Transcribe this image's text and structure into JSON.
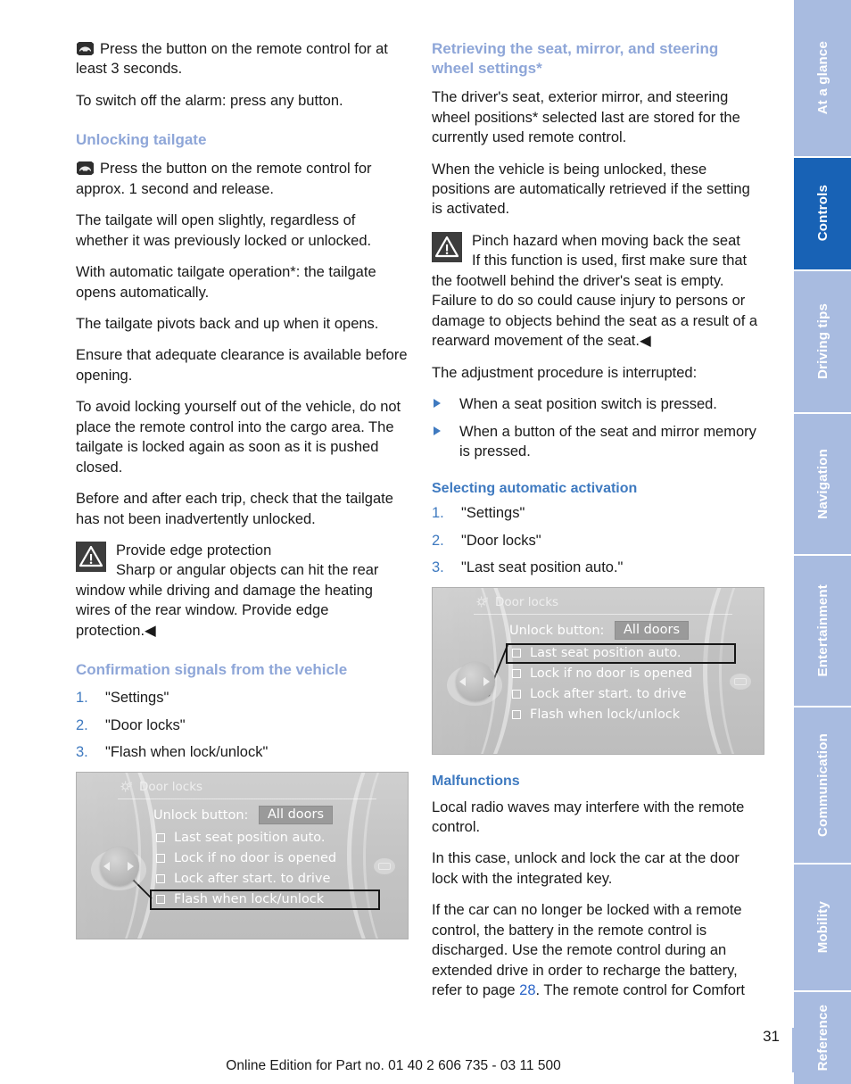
{
  "page": {
    "number": "31",
    "footer": "Online Edition for Part no. 01 40 2 606 735 - 03 11 500"
  },
  "sidebar": {
    "tabs": [
      {
        "label": "At a glance",
        "active": false
      },
      {
        "label": "Controls",
        "active": true
      },
      {
        "label": "Driving tips",
        "active": false
      },
      {
        "label": "Navigation",
        "active": false
      },
      {
        "label": "Entertainment",
        "active": false
      },
      {
        "label": "Communication",
        "active": false
      },
      {
        "label": "Mobility",
        "active": false
      },
      {
        "label": "Reference",
        "active": false
      }
    ],
    "active_color": "#1862b5",
    "inactive_color": "#a8bbe0"
  },
  "left_column": {
    "intro_key_paragraph": "Press the button on the remote control for at least 3 seconds.",
    "alarm_off": "To switch off the alarm: press any button.",
    "heading_unlocking_tailgate": "Unlocking tailgate",
    "tailgate_key_paragraph": "Press the button on the remote control for approx. 1 second and release.",
    "paragraphs": [
      "The tailgate will open slightly, regardless of whether it was previously locked or unlocked.",
      "With automatic tailgate operation*: the tailgate opens automatically.",
      "The tailgate pivots back and up when it opens.",
      "Ensure that adequate clearance is available before opening.",
      "To avoid locking yourself out of the vehicle, do not place the remote control into the cargo area. The tailgate is locked again as soon as it is pushed closed.",
      "Before and after each trip, check that the tailgate has not been inadvertently unlocked."
    ],
    "warning": {
      "title": "Provide edge protection",
      "body": "Sharp or angular objects can hit the rear window while driving and damage the heating wires of the rear window. Provide edge protection.◀"
    },
    "heading_confirmation": "Confirmation signals from the vehicle",
    "steps": [
      {
        "num": "1.",
        "text": "\"Settings\""
      },
      {
        "num": "2.",
        "text": "\"Door locks\""
      },
      {
        "num": "3.",
        "text": "\"Flash when lock/unlock\""
      }
    ],
    "idrive": {
      "title": "Door locks",
      "unlock_label": "Unlock button:",
      "unlock_value": "All doors",
      "options": [
        {
          "label": "Last seat position auto.",
          "selected": false
        },
        {
          "label": "Lock if no door is opened",
          "selected": false
        },
        {
          "label": "Lock after start. to drive",
          "selected": false
        },
        {
          "label": "Flash when lock/unlock",
          "selected": true
        }
      ]
    }
  },
  "right_column": {
    "heading_retrieving": "Retrieving the seat, mirror, and steering wheel settings*",
    "paragraphs_top": [
      "The driver's seat, exterior mirror, and steering wheel positions* selected last are stored for the currently used remote control.",
      "When the vehicle is being unlocked, these positions are automatically retrieved if the setting is activated."
    ],
    "warning": {
      "title": "Pinch hazard when moving back the seat",
      "body": "If this function is used, first make sure that the footwell behind the driver's seat is empty. Failure to do so could cause injury to persons or damage to objects behind the seat as a result of a rearward movement of the seat.◀"
    },
    "interrupt_intro": "The adjustment procedure is interrupted:",
    "interrupt_items": [
      "When a seat position switch is pressed.",
      "When a button of the seat and mirror memory is pressed."
    ],
    "heading_selecting": "Selecting automatic activation",
    "steps": [
      {
        "num": "1.",
        "text": "\"Settings\""
      },
      {
        "num": "2.",
        "text": "\"Door locks\""
      },
      {
        "num": "3.",
        "text": "\"Last seat position auto.\""
      }
    ],
    "idrive": {
      "title": "Door locks",
      "unlock_label": "Unlock button:",
      "unlock_value": "All doors",
      "options": [
        {
          "label": "Last seat position auto.",
          "selected": true
        },
        {
          "label": "Lock if no door is opened",
          "selected": false
        },
        {
          "label": "Lock after start. to drive",
          "selected": false
        },
        {
          "label": "Flash when lock/unlock",
          "selected": false
        }
      ]
    },
    "heading_malfunctions": "Malfunctions",
    "malfunction_paragraphs": [
      "Local radio waves may interfere with the remote control.",
      "In this case, unlock and lock the car at the door lock with the integrated key."
    ],
    "battery_part1": "If the car can no longer be locked with a remote control, the battery in the remote control is discharged. Use the remote control during an extended drive in order to recharge the battery, refer to page",
    "battery_ref": "28",
    "battery_part2": ". The remote control for Comfort"
  }
}
